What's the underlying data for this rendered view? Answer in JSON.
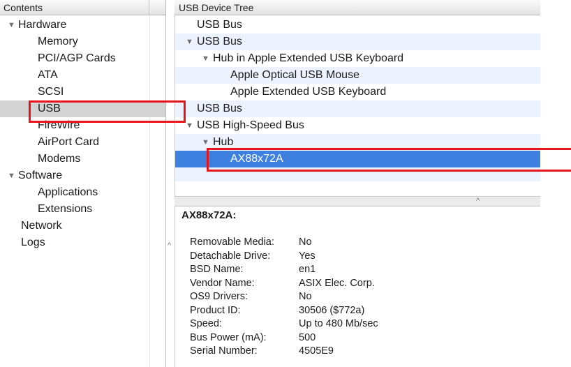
{
  "sidebar": {
    "header": "Contents",
    "items": [
      {
        "label": "Hardware",
        "level": 0,
        "expandable": true
      },
      {
        "label": "Memory",
        "level": 1
      },
      {
        "label": "PCI/AGP Cards",
        "level": 1
      },
      {
        "label": "ATA",
        "level": 1
      },
      {
        "label": "SCSI",
        "level": 1
      },
      {
        "label": "USB",
        "level": 1,
        "selected": true
      },
      {
        "label": "FireWire",
        "level": 1
      },
      {
        "label": "AirPort Card",
        "level": 1
      },
      {
        "label": "Modems",
        "level": 1
      },
      {
        "label": "Software",
        "level": 0,
        "expandable": true
      },
      {
        "label": "Applications",
        "level": 1
      },
      {
        "label": "Extensions",
        "level": 1
      },
      {
        "label": "Network",
        "level": 0
      },
      {
        "label": "Logs",
        "level": 0
      }
    ]
  },
  "device_tree": {
    "header": "USB Device Tree",
    "rows": [
      {
        "label": "USB Bus"
      },
      {
        "label": "USB Bus"
      },
      {
        "label": "Hub in Apple Extended USB Keyboard"
      },
      {
        "label": "Apple Optical USB Mouse"
      },
      {
        "label": "Apple Extended USB Keyboard"
      },
      {
        "label": "USB Bus"
      },
      {
        "label": "USB High-Speed Bus"
      },
      {
        "label": "Hub"
      },
      {
        "label": "AX88x72A",
        "selected": true
      }
    ]
  },
  "detail": {
    "title": "AX88x72A:",
    "properties": [
      {
        "label": "Removable Media:",
        "value": "No"
      },
      {
        "label": "Detachable Drive:",
        "value": "Yes"
      },
      {
        "label": "BSD Name:",
        "value": "en1"
      },
      {
        "label": "Vendor Name:",
        "value": "ASIX Elec. Corp."
      },
      {
        "label": "OS9 Drivers:",
        "value": "No"
      },
      {
        "label": "Product ID:",
        "value": "30506 ($772a)"
      },
      {
        "label": "Speed:",
        "value": "Up to 480 Mb/sec"
      },
      {
        "label": "Bus Power (mA):",
        "value": "500"
      },
      {
        "label": "Serial Number:",
        "value": "4505E9"
      }
    ]
  },
  "icons": {
    "expand": "disclosure-triangle-icon",
    "split": "chevron-up-icon",
    "collapse": "chevron-up-icon"
  },
  "colors": {
    "selection_blue": "#3d80df",
    "sidebar_selected": "#d4d4d4",
    "alt_row": "#edf3fe",
    "highlight_red": "#e8141c"
  }
}
